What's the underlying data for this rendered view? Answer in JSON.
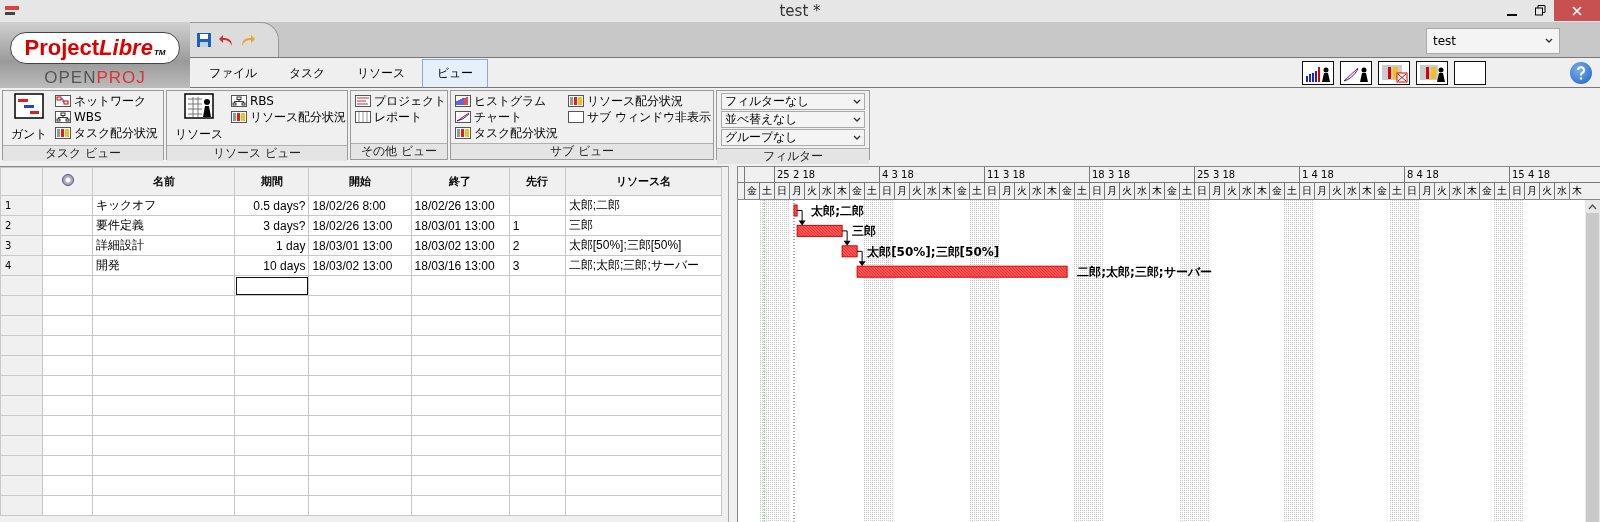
{
  "window": {
    "title": "test *"
  },
  "logo": {
    "name_main": "Project",
    "name_accent": "Libre",
    "trademark": "TM",
    "sub_main": "OPEN",
    "sub_accent": "PROJ"
  },
  "project_select": {
    "value": "test"
  },
  "tabs": [
    {
      "label": "ファイル",
      "selected": false
    },
    {
      "label": "タスク",
      "selected": false
    },
    {
      "label": "リソース",
      "selected": false
    },
    {
      "label": "ビュー",
      "selected": true
    }
  ],
  "ribbon": [
    {
      "title": "タスク ビュー",
      "large": {
        "label": "ガント",
        "kind": "gantt"
      },
      "items": [
        {
          "label": "ネットワーク",
          "kind": "network"
        },
        {
          "label": "WBS",
          "kind": "wbs"
        },
        {
          "label": "タスク配分状況",
          "kind": "usage"
        }
      ]
    },
    {
      "title": "リソース ビュー",
      "large": {
        "label": "リソース",
        "kind": "resource"
      },
      "items": [
        {
          "label": "RBS",
          "kind": "wbs"
        },
        {
          "label": "リソース配分状況",
          "kind": "usage"
        }
      ]
    },
    {
      "title": "その他 ビュー",
      "items": [
        {
          "label": "プロジェクト",
          "kind": "project"
        },
        {
          "label": "レポート",
          "kind": "report"
        }
      ]
    },
    {
      "title": "サブ ビュー",
      "items": [
        {
          "label": "ヒストグラム",
          "kind": "histogram"
        },
        {
          "label": "チャート",
          "kind": "chart"
        },
        {
          "label": "タスク配分状況",
          "kind": "usage"
        },
        {
          "label": "リソース配分状況",
          "kind": "usage"
        },
        {
          "label": "サブ ウィンドウ非表示",
          "kind": "blank"
        }
      ]
    },
    {
      "title": "フィルター",
      "selects": [
        "フィルターなし",
        "並べ替えなし",
        "グループなし"
      ]
    }
  ],
  "table": {
    "columns": [
      "名前",
      "期間",
      "開始",
      "終了",
      "先行",
      "リソース名"
    ],
    "rows": [
      {
        "kind": "task",
        "number": "1",
        "name": "キックオフ",
        "duration": "0.5 days?",
        "start": "18/02/26 8:00",
        "finish": "18/02/26 13:00",
        "predecessors": "",
        "resources": "太郎;二郎"
      },
      {
        "kind": "task",
        "number": "2",
        "name": "要件定義",
        "duration": "3 days?",
        "start": "18/02/26 13:00",
        "finish": "18/03/01 13:00",
        "predecessors": "1",
        "resources": "三郎"
      },
      {
        "kind": "task",
        "number": "3",
        "name": "詳細設計",
        "duration": "1 day",
        "start": "18/03/01 13:00",
        "finish": "18/03/02 13:00",
        "predecessors": "2",
        "resources": "太郎[50%];三郎[50%]"
      },
      {
        "kind": "task",
        "number": "4",
        "name": "開発",
        "duration": "10 days",
        "start": "18/03/02 13:00",
        "finish": "18/03/16 13:00",
        "predecessors": "3",
        "resources": "二郎;太郎;三郎;サーバー"
      },
      {
        "kind": "blank",
        "duration_focused": true
      }
    ]
  },
  "gantt": {
    "weeks": [
      "25 2 18",
      "4 3 18",
      "11 3 18",
      "18 3 18",
      "25 3 18",
      "1 4 18",
      "8 4 18",
      "15 4 18"
    ],
    "days": [
      {
        "label": "金",
        "nonworking": false
      },
      {
        "label": "土",
        "nonworking": true
      },
      {
        "label": "日",
        "nonworking": true
      },
      {
        "label": "月",
        "nonworking": false
      },
      {
        "label": "火",
        "nonworking": false
      },
      {
        "label": "水",
        "nonworking": false
      },
      {
        "label": "木",
        "nonworking": false
      },
      {
        "label": "金",
        "nonworking": false
      },
      {
        "label": "土",
        "nonworking": true
      },
      {
        "label": "日",
        "nonworking": true
      },
      {
        "label": "月",
        "nonworking": false
      },
      {
        "label": "火",
        "nonworking": false
      },
      {
        "label": "水",
        "nonworking": false
      },
      {
        "label": "木",
        "nonworking": false
      },
      {
        "label": "金",
        "nonworking": false
      },
      {
        "label": "土",
        "nonworking": true
      },
      {
        "label": "日",
        "nonworking": true
      },
      {
        "label": "月",
        "nonworking": false
      },
      {
        "label": "火",
        "nonworking": false
      },
      {
        "label": "水",
        "nonworking": false
      },
      {
        "label": "木",
        "nonworking": false
      },
      {
        "label": "金",
        "nonworking": false
      },
      {
        "label": "土",
        "nonworking": true
      },
      {
        "label": "日",
        "nonworking": true
      },
      {
        "label": "月",
        "nonworking": false
      },
      {
        "label": "火",
        "nonworking": false
      },
      {
        "label": "水",
        "nonworking": false
      },
      {
        "label": "木",
        "nonworking": false
      },
      {
        "label": "金",
        "nonworking": false
      },
      {
        "label": "土",
        "nonworking": true
      },
      {
        "label": "日",
        "nonworking": true
      },
      {
        "label": "月",
        "nonworking": false
      },
      {
        "label": "火",
        "nonworking": false
      },
      {
        "label": "水",
        "nonworking": false
      },
      {
        "label": "木",
        "nonworking": false
      },
      {
        "label": "金",
        "nonworking": false
      },
      {
        "label": "土",
        "nonworking": true
      },
      {
        "label": "日",
        "nonworking": true
      },
      {
        "label": "月",
        "nonworking": false
      },
      {
        "label": "火",
        "nonworking": false
      },
      {
        "label": "水",
        "nonworking": false
      },
      {
        "label": "木",
        "nonworking": false
      },
      {
        "label": "金",
        "nonworking": false
      },
      {
        "label": "土",
        "nonworking": true
      },
      {
        "label": "日",
        "nonworking": true
      },
      {
        "label": "月",
        "nonworking": false
      },
      {
        "label": "火",
        "nonworking": false
      },
      {
        "label": "水",
        "nonworking": false
      },
      {
        "label": "木",
        "nonworking": false
      },
      {
        "label": "金",
        "nonworking": false
      },
      {
        "label": "土",
        "nonworking": true
      },
      {
        "label": "日",
        "nonworking": true
      },
      {
        "label": "月",
        "nonworking": false
      },
      {
        "label": "火",
        "nonworking": false
      },
      {
        "label": "水",
        "nonworking": false
      },
      {
        "label": "木",
        "nonworking": false
      }
    ],
    "bars": [
      {
        "label": "太郎;二郎"
      },
      {
        "label": "三郎"
      },
      {
        "label": "太郎[50%];三郎[50%]"
      },
      {
        "label": "二郎;太郎;三郎;サーバー"
      }
    ]
  }
}
